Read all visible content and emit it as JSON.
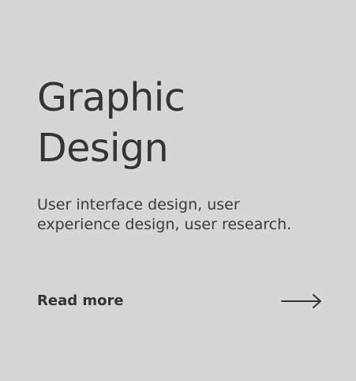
{
  "card": {
    "title_line1": "Graphic",
    "title_line2": "Design",
    "description_line1": "User interface design, user",
    "description_line2": "experience design, user research.",
    "link_label": "Read more",
    "arrow_icon": "arrow-right-icon",
    "background_color": "#d6d6d6",
    "text_color": "#343434"
  }
}
